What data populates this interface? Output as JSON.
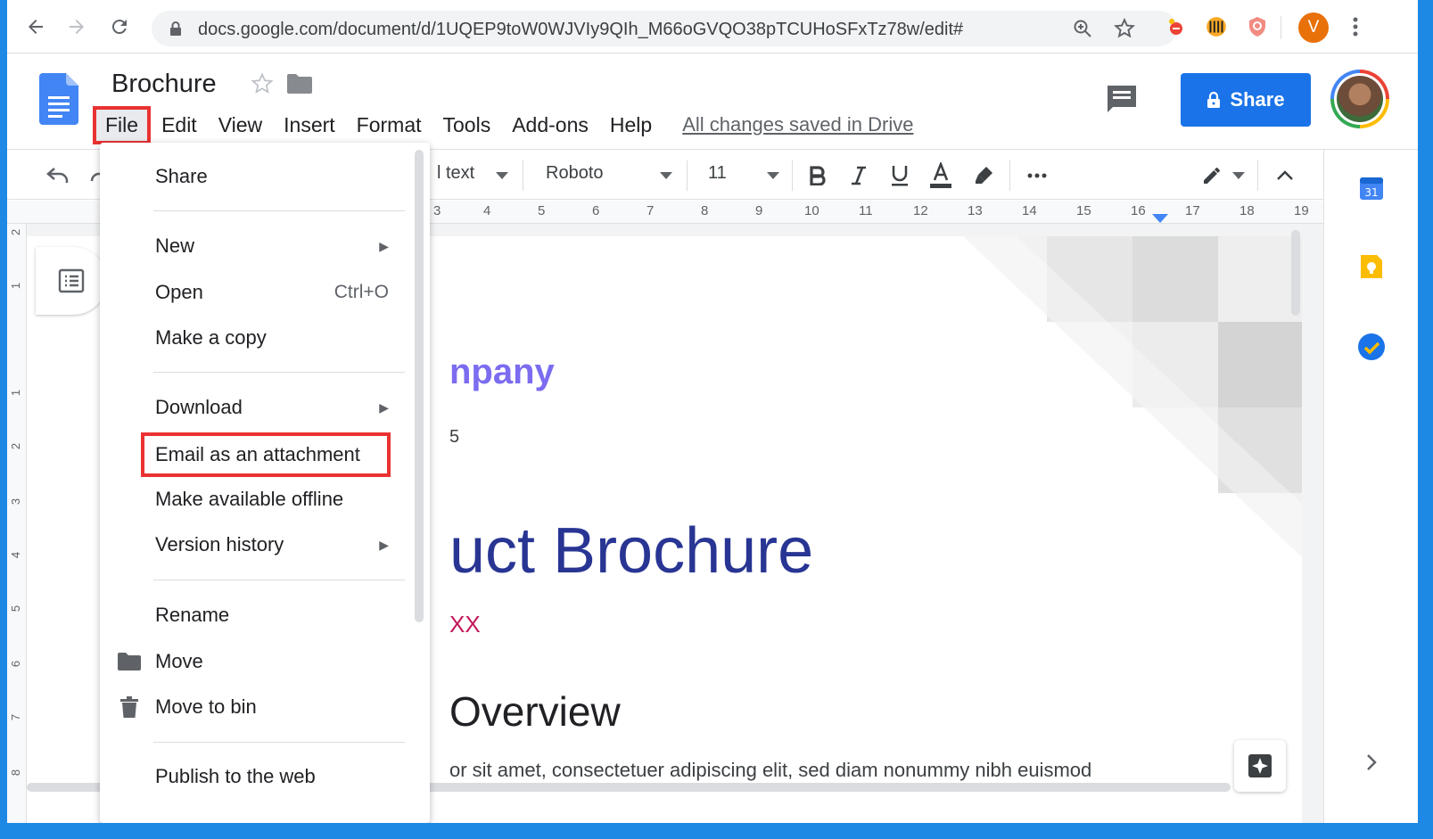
{
  "browser": {
    "url": "docs.google.com/document/d/1UQEP9toW0WJVIy9QIh_M66oGVQO38pTCUHoSFxTz78w/edit#",
    "profile_initial": "V",
    "colors": {
      "profile": "#e8710a",
      "accent": "#1a73e8"
    }
  },
  "docs": {
    "title": "Brochure",
    "menu": [
      "File",
      "Edit",
      "View",
      "Insert",
      "Format",
      "Tools",
      "Add-ons",
      "Help"
    ],
    "saved_status": "All changes saved in Drive",
    "share_label": "Share"
  },
  "toolbar": {
    "style": "l text",
    "font": "Roboto",
    "size": "11"
  },
  "ruler": [
    "3",
    "4",
    "5",
    "6",
    "7",
    "8",
    "9",
    "10",
    "11",
    "12",
    "13",
    "14",
    "15",
    "16",
    "17",
    "18",
    "19"
  ],
  "vruler": [
    "2",
    "1",
    "1",
    "2",
    "3",
    "4",
    "5",
    "6",
    "7",
    "8"
  ],
  "document": {
    "company": "npany",
    "small_digit": "5",
    "title": "uct Brochure",
    "date": "XX",
    "heading": "Overview",
    "body": "or sit amet, consectetuer adipiscing elit, sed diam nonummy nibh euismod"
  },
  "file_menu": {
    "share": "Share",
    "new": "New",
    "open": "Open",
    "open_shortcut": "Ctrl+O",
    "make_copy": "Make a copy",
    "download": "Download",
    "email": "Email as an attachment",
    "offline": "Make available offline",
    "version_history": "Version history",
    "rename": "Rename",
    "move": "Move",
    "move_to_bin": "Move to bin",
    "publish": "Publish to the web"
  },
  "side_panel": {
    "calendar_day": "31"
  }
}
